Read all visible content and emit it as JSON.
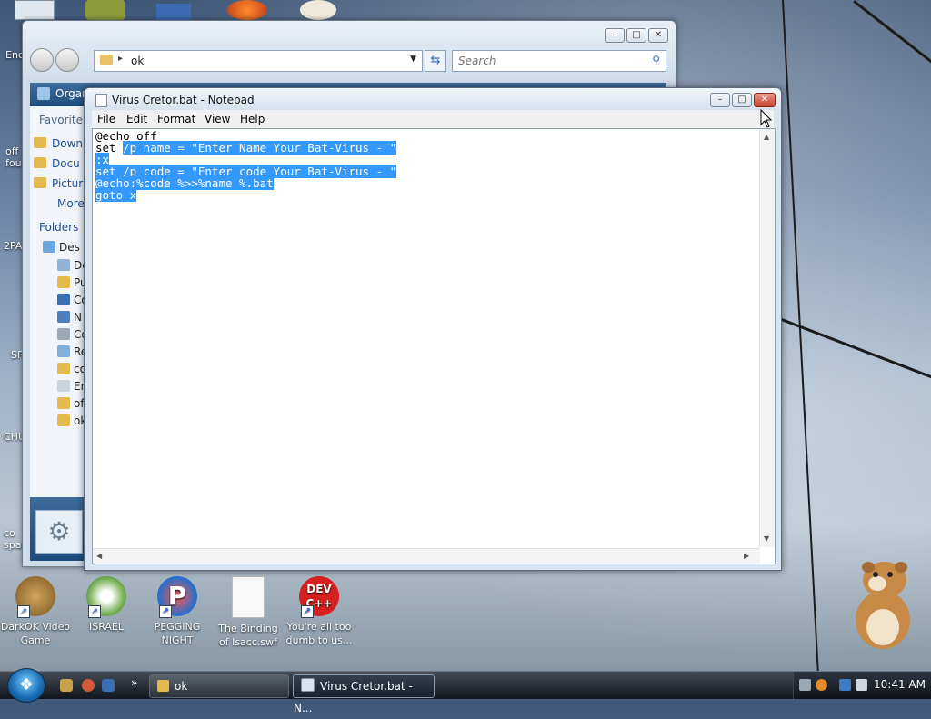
{
  "desktop": {
    "icons": [
      {
        "label": "DarkOK Video Game",
        "icon": "money-bag-icon"
      },
      {
        "label": "ISRAEL",
        "icon": "flower-icon"
      },
      {
        "label": "PEGGING NIGHT",
        "icon": "p-logo-icon"
      },
      {
        "label": "The Binding of Isacc.swf",
        "icon": "blank-file-icon"
      },
      {
        "label": "You're all too dumb to us...",
        "icon": "dev-cpp-icon"
      }
    ],
    "partial_labels": [
      "Enc",
      "off fou",
      "2PA",
      "SP",
      "CHU",
      "co spar"
    ]
  },
  "explorer": {
    "address": "ok",
    "search_placeholder": "Search",
    "toolbar_label": "Organ",
    "favorite_links_header": "Favorite L",
    "favorites": [
      "Down",
      "Docu",
      "Pictur"
    ],
    "more_label": "More",
    "folders_header": "Folders",
    "tree": [
      "Des",
      "De",
      "Pu",
      "Co",
      "N",
      "Co",
      "Re",
      "co",
      "En",
      "of",
      "ok"
    ]
  },
  "notepad": {
    "title": "Virus Cretor.bat - Notepad",
    "menu": [
      "File",
      "Edit",
      "Format",
      "View",
      "Help"
    ],
    "lines": {
      "l1": "@echo off",
      "l2_pre": "set ",
      "l2_sel": "/p name = \"Enter Name Your Bat-Virus - \"",
      "l3": ":x",
      "l4": "set /p code = \"Enter code Your Bat-Virus - \"",
      "l5": "@echo:%code %>>%name %.bat",
      "l6": "goto x"
    },
    "selection_color": "#3399ff"
  },
  "taskbar": {
    "tasks": [
      "ok",
      "Virus Cretor.bat - N..."
    ],
    "overflow": "»",
    "clock": "10:41 AM"
  }
}
